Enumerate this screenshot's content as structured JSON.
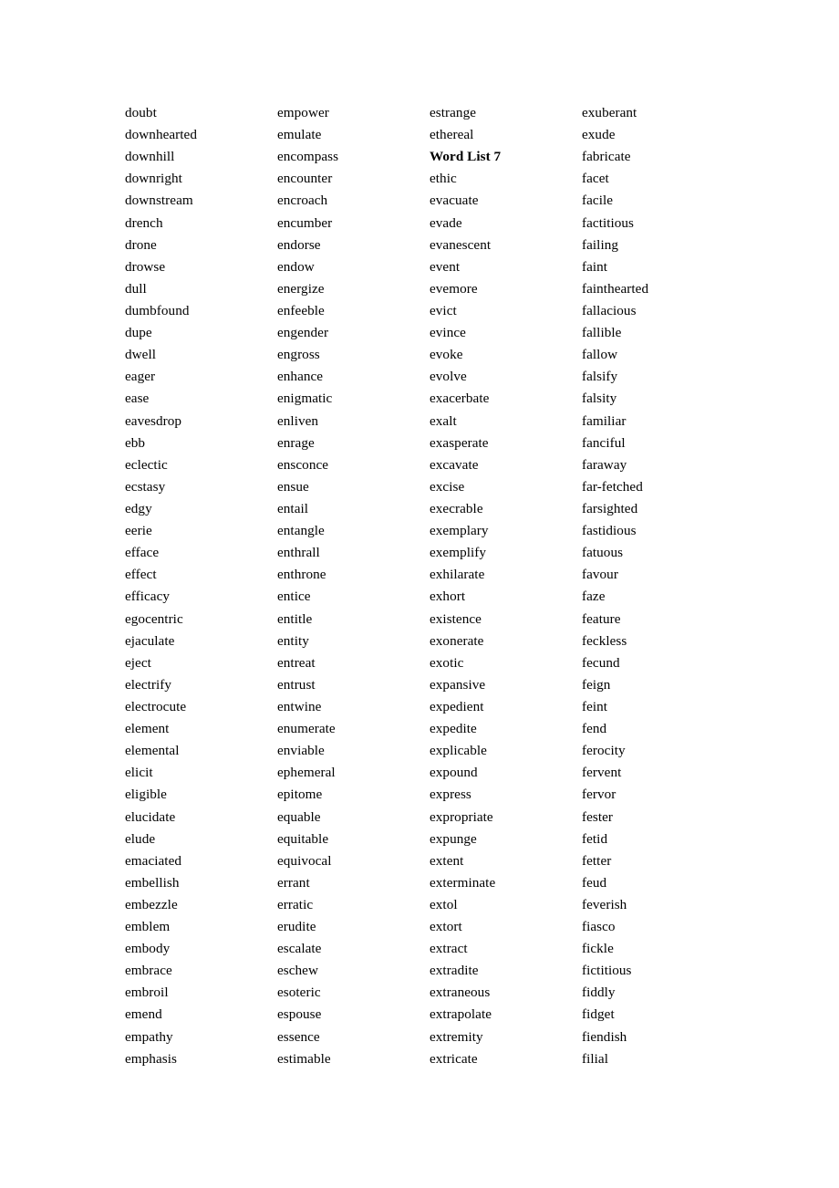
{
  "document": {
    "kind": "word-list",
    "heading_label": "Word List 7",
    "columns": [
      {
        "name": "column-1",
        "entries": [
          {
            "text": "doubt",
            "bold": false
          },
          {
            "text": "downhearted",
            "bold": false
          },
          {
            "text": "downhill",
            "bold": false
          },
          {
            "text": "downright",
            "bold": false
          },
          {
            "text": "downstream",
            "bold": false
          },
          {
            "text": "drench",
            "bold": false
          },
          {
            "text": "drone",
            "bold": false
          },
          {
            "text": "drowse",
            "bold": false
          },
          {
            "text": "dull",
            "bold": false
          },
          {
            "text": "dumbfound",
            "bold": false
          },
          {
            "text": "dupe",
            "bold": false
          },
          {
            "text": "dwell",
            "bold": false
          },
          {
            "text": "eager",
            "bold": false
          },
          {
            "text": "ease",
            "bold": false
          },
          {
            "text": "eavesdrop",
            "bold": false
          },
          {
            "text": "ebb",
            "bold": false
          },
          {
            "text": "eclectic",
            "bold": false
          },
          {
            "text": "ecstasy",
            "bold": false
          },
          {
            "text": "edgy",
            "bold": false
          },
          {
            "text": "eerie",
            "bold": false
          },
          {
            "text": "efface",
            "bold": false
          },
          {
            "text": "effect",
            "bold": false
          },
          {
            "text": "efficacy",
            "bold": false
          },
          {
            "text": "egocentric",
            "bold": false
          },
          {
            "text": "ejaculate",
            "bold": false
          },
          {
            "text": "eject",
            "bold": false
          },
          {
            "text": "electrify",
            "bold": false
          },
          {
            "text": "electrocute",
            "bold": false
          },
          {
            "text": "element",
            "bold": false
          },
          {
            "text": "elemental",
            "bold": false
          },
          {
            "text": "elicit",
            "bold": false
          },
          {
            "text": "eligible",
            "bold": false
          },
          {
            "text": "elucidate",
            "bold": false
          },
          {
            "text": "elude",
            "bold": false
          },
          {
            "text": "emaciated",
            "bold": false
          },
          {
            "text": "embellish",
            "bold": false
          },
          {
            "text": "embezzle",
            "bold": false
          },
          {
            "text": "emblem",
            "bold": false
          },
          {
            "text": "embody",
            "bold": false
          },
          {
            "text": "embrace",
            "bold": false
          },
          {
            "text": "embroil",
            "bold": false
          },
          {
            "text": "emend",
            "bold": false
          },
          {
            "text": "empathy",
            "bold": false
          },
          {
            "text": "emphasis",
            "bold": false
          }
        ]
      },
      {
        "name": "column-2",
        "entries": [
          {
            "text": "empower",
            "bold": false
          },
          {
            "text": "emulate",
            "bold": false
          },
          {
            "text": "encompass",
            "bold": false
          },
          {
            "text": "encounter",
            "bold": false
          },
          {
            "text": "encroach",
            "bold": false
          },
          {
            "text": "encumber",
            "bold": false
          },
          {
            "text": "endorse",
            "bold": false
          },
          {
            "text": "endow",
            "bold": false
          },
          {
            "text": "energize",
            "bold": false
          },
          {
            "text": "enfeeble",
            "bold": false
          },
          {
            "text": "engender",
            "bold": false
          },
          {
            "text": "engross",
            "bold": false
          },
          {
            "text": "enhance",
            "bold": false
          },
          {
            "text": "enigmatic",
            "bold": false
          },
          {
            "text": "enliven",
            "bold": false
          },
          {
            "text": "enrage",
            "bold": false
          },
          {
            "text": "ensconce",
            "bold": false
          },
          {
            "text": "ensue",
            "bold": false
          },
          {
            "text": "entail",
            "bold": false
          },
          {
            "text": "entangle",
            "bold": false
          },
          {
            "text": "enthrall",
            "bold": false
          },
          {
            "text": "enthrone",
            "bold": false
          },
          {
            "text": "entice",
            "bold": false
          },
          {
            "text": "entitle",
            "bold": false
          },
          {
            "text": "entity",
            "bold": false
          },
          {
            "text": "entreat",
            "bold": false
          },
          {
            "text": "entrust",
            "bold": false
          },
          {
            "text": "entwine",
            "bold": false
          },
          {
            "text": "enumerate",
            "bold": false
          },
          {
            "text": "enviable",
            "bold": false
          },
          {
            "text": "ephemeral",
            "bold": false
          },
          {
            "text": "epitome",
            "bold": false
          },
          {
            "text": "equable",
            "bold": false
          },
          {
            "text": "equitable",
            "bold": false
          },
          {
            "text": "equivocal",
            "bold": false
          },
          {
            "text": "errant",
            "bold": false
          },
          {
            "text": "erratic",
            "bold": false
          },
          {
            "text": "erudite",
            "bold": false
          },
          {
            "text": "escalate",
            "bold": false
          },
          {
            "text": "eschew",
            "bold": false
          },
          {
            "text": "esoteric",
            "bold": false
          },
          {
            "text": "espouse",
            "bold": false
          },
          {
            "text": "essence",
            "bold": false
          },
          {
            "text": "estimable",
            "bold": false
          }
        ]
      },
      {
        "name": "column-3",
        "entries": [
          {
            "text": "estrange",
            "bold": false
          },
          {
            "text": "ethereal",
            "bold": false
          },
          {
            "text": "Word List 7",
            "bold": true
          },
          {
            "text": "ethic",
            "bold": false
          },
          {
            "text": "evacuate",
            "bold": false
          },
          {
            "text": "evade",
            "bold": false
          },
          {
            "text": "evanescent",
            "bold": false
          },
          {
            "text": "event",
            "bold": false
          },
          {
            "text": "evemore",
            "bold": false
          },
          {
            "text": "evict",
            "bold": false
          },
          {
            "text": "evince",
            "bold": false
          },
          {
            "text": "evoke",
            "bold": false
          },
          {
            "text": "evolve",
            "bold": false
          },
          {
            "text": "exacerbate",
            "bold": false
          },
          {
            "text": "exalt",
            "bold": false
          },
          {
            "text": "exasperate",
            "bold": false
          },
          {
            "text": "excavate",
            "bold": false
          },
          {
            "text": "excise",
            "bold": false
          },
          {
            "text": "execrable",
            "bold": false
          },
          {
            "text": "exemplary",
            "bold": false
          },
          {
            "text": "exemplify",
            "bold": false
          },
          {
            "text": "exhilarate",
            "bold": false
          },
          {
            "text": "exhort",
            "bold": false
          },
          {
            "text": "existence",
            "bold": false
          },
          {
            "text": "exonerate",
            "bold": false
          },
          {
            "text": "exotic",
            "bold": false
          },
          {
            "text": "expansive",
            "bold": false
          },
          {
            "text": "expedient",
            "bold": false
          },
          {
            "text": "expedite",
            "bold": false
          },
          {
            "text": "explicable",
            "bold": false
          },
          {
            "text": "expound",
            "bold": false
          },
          {
            "text": "express",
            "bold": false
          },
          {
            "text": "expropriate",
            "bold": false
          },
          {
            "text": "expunge",
            "bold": false
          },
          {
            "text": "extent",
            "bold": false
          },
          {
            "text": "exterminate",
            "bold": false
          },
          {
            "text": "extol",
            "bold": false
          },
          {
            "text": "extort",
            "bold": false
          },
          {
            "text": "extract",
            "bold": false
          },
          {
            "text": "extradite",
            "bold": false
          },
          {
            "text": "extraneous",
            "bold": false
          },
          {
            "text": "extrapolate",
            "bold": false
          },
          {
            "text": "extremity",
            "bold": false
          },
          {
            "text": "extricate",
            "bold": false
          }
        ]
      },
      {
        "name": "column-4",
        "entries": [
          {
            "text": "exuberant",
            "bold": false
          },
          {
            "text": "exude",
            "bold": false
          },
          {
            "text": "fabricate",
            "bold": false
          },
          {
            "text": "facet",
            "bold": false
          },
          {
            "text": "facile",
            "bold": false
          },
          {
            "text": "factitious",
            "bold": false
          },
          {
            "text": "failing",
            "bold": false
          },
          {
            "text": "faint",
            "bold": false
          },
          {
            "text": "fainthearted",
            "bold": false
          },
          {
            "text": "fallacious",
            "bold": false
          },
          {
            "text": "fallible",
            "bold": false
          },
          {
            "text": "fallow",
            "bold": false
          },
          {
            "text": "falsify",
            "bold": false
          },
          {
            "text": "falsity",
            "bold": false
          },
          {
            "text": "familiar",
            "bold": false
          },
          {
            "text": "fanciful",
            "bold": false
          },
          {
            "text": "faraway",
            "bold": false
          },
          {
            "text": "far-fetched",
            "bold": false
          },
          {
            "text": "farsighted",
            "bold": false
          },
          {
            "text": "fastidious",
            "bold": false
          },
          {
            "text": "fatuous",
            "bold": false
          },
          {
            "text": "favour",
            "bold": false
          },
          {
            "text": "faze",
            "bold": false
          },
          {
            "text": "feature",
            "bold": false
          },
          {
            "text": "feckless",
            "bold": false
          },
          {
            "text": "fecund",
            "bold": false
          },
          {
            "text": "feign",
            "bold": false
          },
          {
            "text": "feint",
            "bold": false
          },
          {
            "text": "fend",
            "bold": false
          },
          {
            "text": "ferocity",
            "bold": false
          },
          {
            "text": "fervent",
            "bold": false
          },
          {
            "text": "fervor",
            "bold": false
          },
          {
            "text": "fester",
            "bold": false
          },
          {
            "text": "fetid",
            "bold": false
          },
          {
            "text": "fetter",
            "bold": false
          },
          {
            "text": "feud",
            "bold": false
          },
          {
            "text": "feverish",
            "bold": false
          },
          {
            "text": "fiasco",
            "bold": false
          },
          {
            "text": "fickle",
            "bold": false
          },
          {
            "text": "fictitious",
            "bold": false
          },
          {
            "text": "fiddly",
            "bold": false
          },
          {
            "text": "fidget",
            "bold": false
          },
          {
            "text": "fiendish",
            "bold": false
          },
          {
            "text": "filial",
            "bold": false
          }
        ]
      }
    ]
  }
}
